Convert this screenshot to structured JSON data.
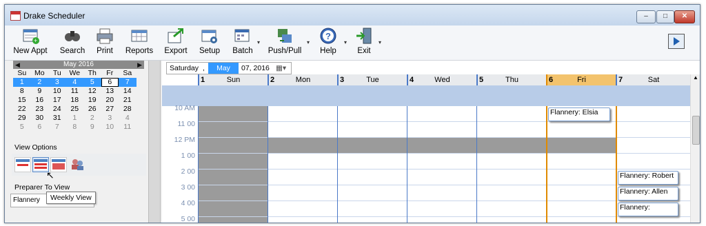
{
  "window": {
    "title": "Drake Scheduler",
    "min": "–",
    "max": "□",
    "close": "✕"
  },
  "toolbar": [
    {
      "label": "New Appt",
      "icon": "new-appointment-icon"
    },
    {
      "label": "Search",
      "icon": "binoculars-icon"
    },
    {
      "label": "Print",
      "icon": "printer-icon"
    },
    {
      "label": "Reports",
      "icon": "reports-icon"
    },
    {
      "label": "Export",
      "icon": "export-icon"
    },
    {
      "label": "Setup",
      "icon": "setup-icon"
    },
    {
      "label": "Batch",
      "icon": "batch-icon"
    },
    {
      "label": "Push/Pull",
      "icon": "push-pull-icon"
    },
    {
      "label": "Help",
      "icon": "help-icon"
    },
    {
      "label": "Exit",
      "icon": "exit-door-icon"
    }
  ],
  "minical": {
    "month": "May 2016",
    "prev": "◀",
    "next": "▶",
    "weekdays": [
      "Su",
      "Mo",
      "Tu",
      "We",
      "Th",
      "Fr",
      "Sa"
    ],
    "weeks": [
      [
        "1",
        "2",
        "3",
        "4",
        "5",
        "6",
        "7"
      ],
      [
        "8",
        "9",
        "10",
        "11",
        "12",
        "13",
        "14"
      ],
      [
        "15",
        "16",
        "17",
        "18",
        "19",
        "20",
        "21"
      ],
      [
        "22",
        "23",
        "24",
        "25",
        "26",
        "27",
        "28"
      ],
      [
        "29",
        "30",
        "31",
        "1",
        "2",
        "3",
        "4"
      ],
      [
        "5",
        "6",
        "7",
        "8",
        "9",
        "10",
        "11"
      ]
    ]
  },
  "view_options": {
    "label": "View Options",
    "tooltip": "Weekly View"
  },
  "preparer": {
    "label": "Preparer To View",
    "value": "Flannery"
  },
  "datebar": {
    "weekday": "Saturday",
    "sep": ",",
    "month": "May",
    "rest": "07, 2016",
    "dropdown": "▦▾"
  },
  "days": [
    {
      "num": "1",
      "name": "Sun"
    },
    {
      "num": "2",
      "name": "Mon"
    },
    {
      "num": "3",
      "name": "Tue"
    },
    {
      "num": "4",
      "name": "Wed"
    },
    {
      "num": "5",
      "name": "Thu"
    },
    {
      "num": "6",
      "name": "Fri"
    },
    {
      "num": "7",
      "name": "Sat"
    }
  ],
  "times": [
    "10 AM",
    "11 00",
    "12 PM",
    "1 00",
    "2 00",
    "3 00",
    "4 00",
    "5 00"
  ],
  "appointments": [
    {
      "text": "Flannery: Elsia",
      "day": 5,
      "slot": 0
    },
    {
      "text": "Flannery: Robert",
      "day": 6,
      "slot": 4
    },
    {
      "text": "Flannery: Allen",
      "day": 6,
      "slot": 5
    },
    {
      "text": "Flannery:",
      "day": 6,
      "slot": 6
    }
  ],
  "scroll_up": "▲"
}
